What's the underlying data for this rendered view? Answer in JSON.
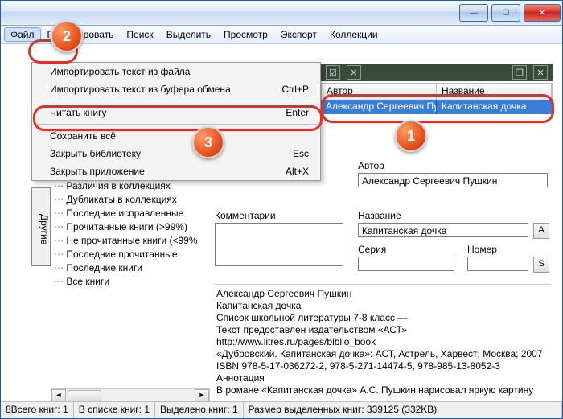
{
  "menubar": {
    "file": "Файл",
    "edit": "Редактировать",
    "search": "Поиск",
    "select": "Выделить",
    "view": "Просмотр",
    "export": "Экспорт",
    "collections": "Коллекции"
  },
  "dropdown": {
    "import_file": "Импортировать текст из файла",
    "import_clip": "Импортировать текст из буфера обмена",
    "import_clip_key": "Ctrl+P",
    "read_book": "Читать книгу",
    "read_book_key": "Enter",
    "save_all": "Сохранить всё",
    "close_lib": "Закрыть библиотеку",
    "close_lib_key": "Esc",
    "close_app": "Закрыть приложение",
    "close_app_key": "Alt+X"
  },
  "table": {
    "col_author": "Автор",
    "col_title": "Название",
    "row_author": "Александр Сергеевич Пу…",
    "row_title": "Капитанская дочка"
  },
  "fields": {
    "author_label": "Автор",
    "author_value": "Александр Сергеевич Пушкин",
    "comments_label": "Комментарии",
    "title_label": "Название",
    "title_value": "Капитанская дочка",
    "series_label": "Серия",
    "number_label": "Номер",
    "a_btn": "A",
    "s_btn": "S"
  },
  "sidetab": "Другие",
  "tree": {
    "i1": "Различия в коллекциях",
    "i2": "Дубликаты в коллекциях",
    "i3": "Последние исправленные",
    "i4": "Прочитанные книги (>99%)",
    "i5": "Не прочитанные книги (<99%",
    "i6": "Последние прочитанные",
    "i7": "Последние книги",
    "i8": "Все книги"
  },
  "desc": {
    "l1": "Александр Сергеевич Пушкин",
    "l2": "Капитанская дочка",
    "l3": "Список школьной литературы 7-8 класс —",
    "l4": "Текст предоставлен издательством «АСТ» http://www.litres.ru/pages/biblio_book",
    "l5": "«Дубровский. Капитанская дочка»: АСТ, Астрель, Харвест; Москва; 2007",
    "l6": "ISBN 978-5-17-036272-2, 978-5-271-14474-5, 978-985-13-8052-3",
    "l7": "Аннотация",
    "l8": "В романе «Капитанская дочка» А.С. Пушкин нарисовал яркую картину стихийного"
  },
  "status": {
    "s1": "8Всего книг: 1",
    "s2": "В списке книг: 1",
    "s3": "Выделено книг: 1",
    "s4": "Размер выделенных книг: 339125  (332KB)"
  },
  "badges": {
    "b1": "1",
    "b2": "2",
    "b3": "3"
  }
}
